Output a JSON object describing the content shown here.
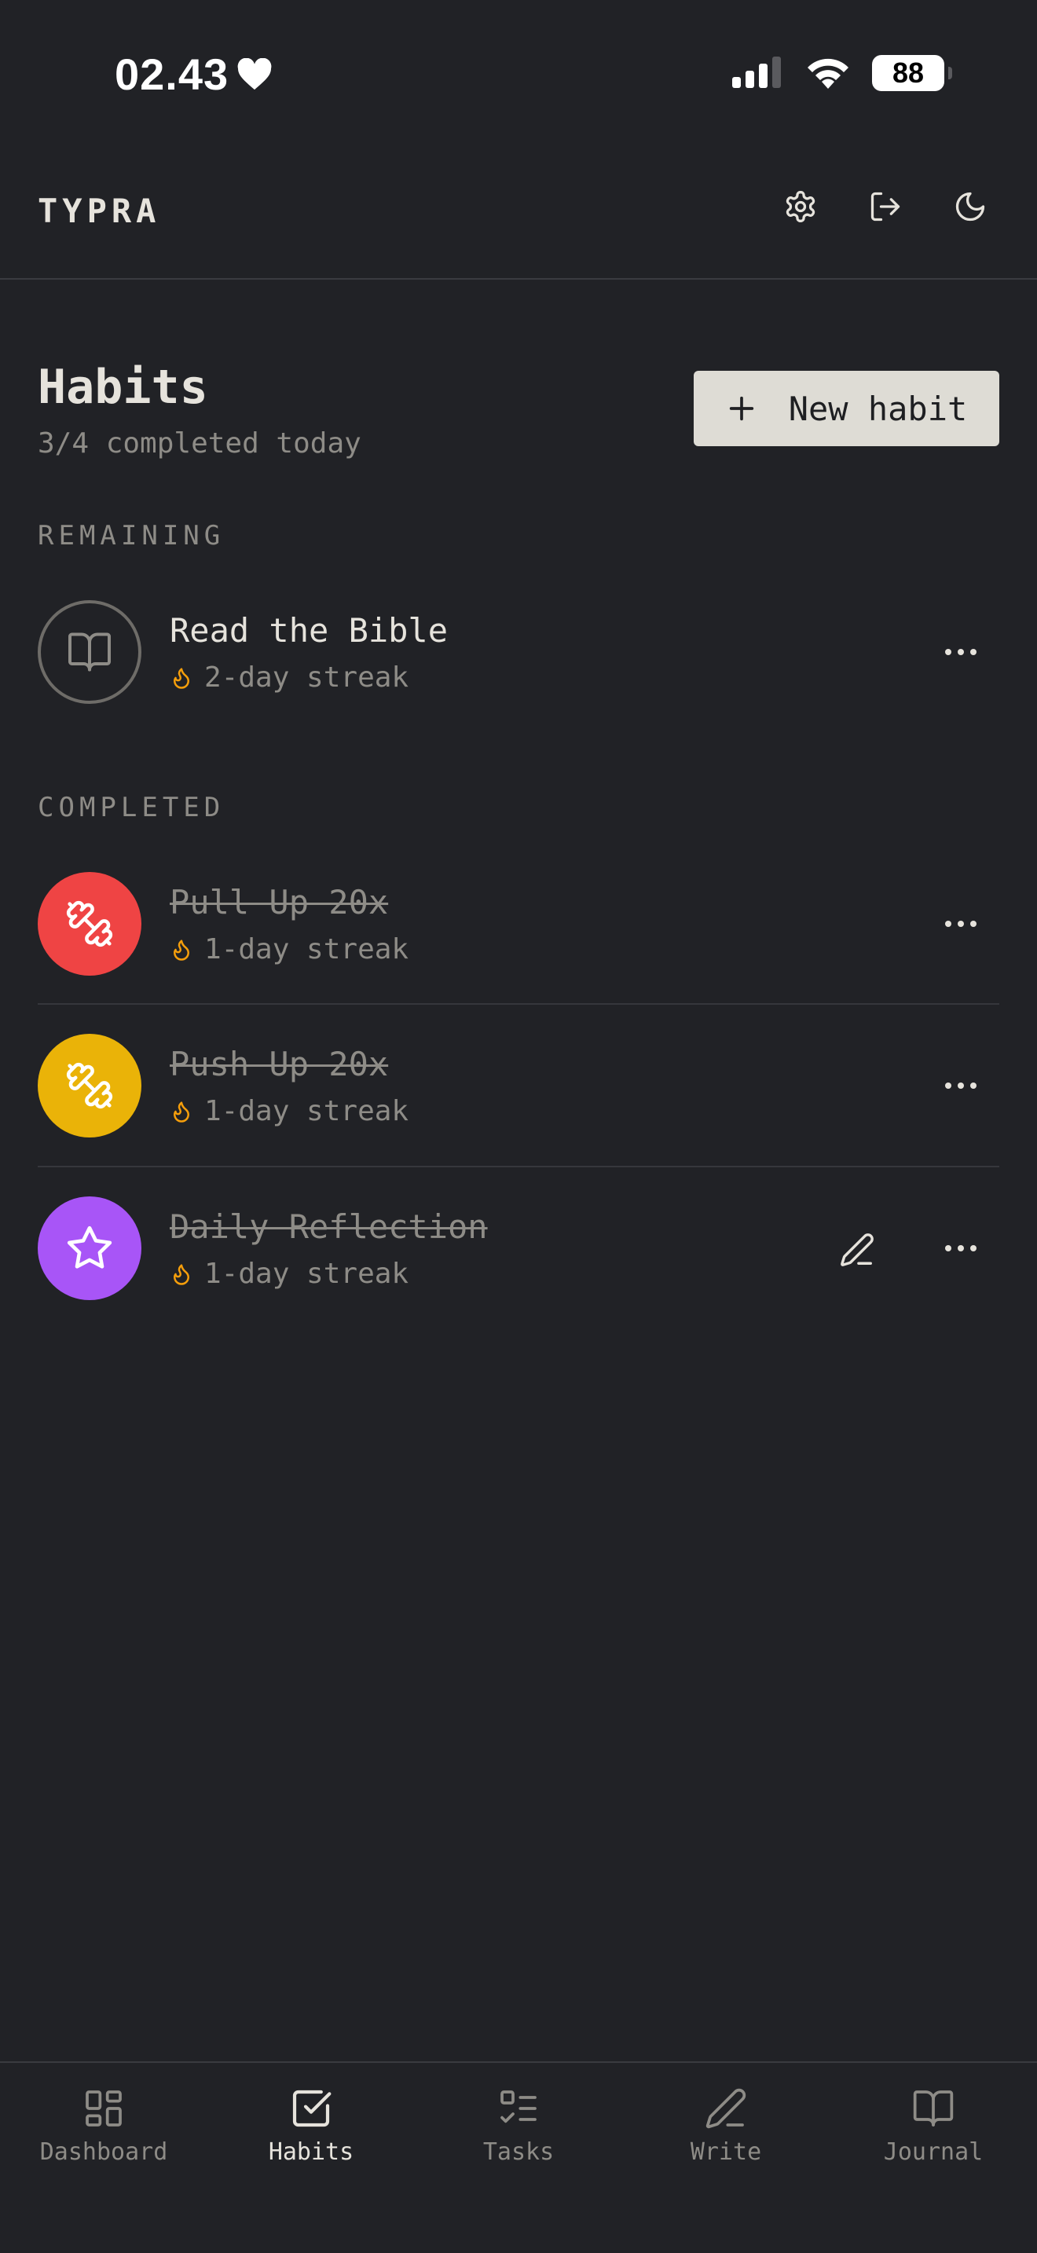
{
  "status": {
    "time": "02.43",
    "battery": "88"
  },
  "header": {
    "app_title": "TYPRA"
  },
  "page": {
    "title": "Habits",
    "subtitle": "3/4 completed today",
    "new_button_label": "New habit"
  },
  "sections": {
    "remaining": "REMAINING",
    "completed": "COMPLETED"
  },
  "habits": {
    "remaining": [
      {
        "name": "Read the Bible",
        "streak": "2-day streak",
        "icon": "book-icon",
        "color": "none"
      }
    ],
    "completed": [
      {
        "name": "Pull Up 20x",
        "streak": "1-day streak",
        "icon": "dumbbell-icon",
        "color": "#ef4444"
      },
      {
        "name": "Push Up 20x",
        "streak": "1-day streak",
        "icon": "dumbbell-icon",
        "color": "#eab308"
      },
      {
        "name": "Daily Reflection",
        "streak": "1-day streak",
        "icon": "star-icon",
        "color": "#a855f7"
      }
    ]
  },
  "nav": [
    {
      "label": "Dashboard",
      "icon": "dashboard-icon",
      "active": false
    },
    {
      "label": "Habits",
      "icon": "checkbox-icon",
      "active": true
    },
    {
      "label": "Tasks",
      "icon": "tasks-icon",
      "active": false
    },
    {
      "label": "Write",
      "icon": "pen-icon",
      "active": false
    },
    {
      "label": "Journal",
      "icon": "book-icon",
      "active": false
    }
  ],
  "colors": {
    "background": "#212226",
    "accent_button": "#dedcd5",
    "flame": "#f59e0b"
  }
}
